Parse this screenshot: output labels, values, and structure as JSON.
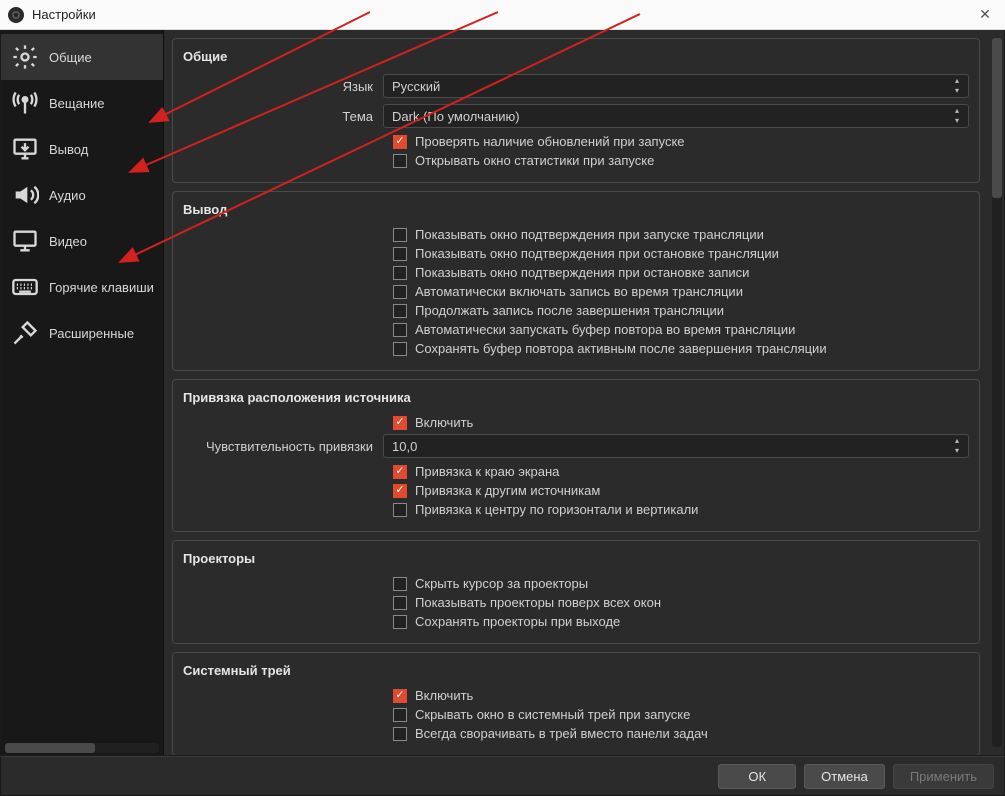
{
  "window": {
    "title": "Настройки"
  },
  "sidebar": {
    "items": [
      {
        "label": "Общие"
      },
      {
        "label": "Вещание"
      },
      {
        "label": "Вывод"
      },
      {
        "label": "Аудио"
      },
      {
        "label": "Видео"
      },
      {
        "label": "Горячие клавиши"
      },
      {
        "label": "Расширенные"
      }
    ]
  },
  "groups": {
    "general": {
      "title": "Общие",
      "language_label": "Язык",
      "language_value": "Русский",
      "theme_label": "Тема",
      "theme_value": "Dark (По умолчанию)",
      "checks": [
        {
          "label": "Проверять наличие обновлений при запуске",
          "checked": true
        },
        {
          "label": "Открывать окно статистики при запуске",
          "checked": false
        }
      ]
    },
    "output": {
      "title": "Вывод",
      "checks": [
        {
          "label": "Показывать окно подтверждения при запуске трансляции",
          "checked": false
        },
        {
          "label": "Показывать окно подтверждения при остановке трансляции",
          "checked": false
        },
        {
          "label": "Показывать окно подтверждения при остановке записи",
          "checked": false
        },
        {
          "label": "Автоматически включать запись во время трансляции",
          "checked": false
        },
        {
          "label": "Продолжать запись после завершения трансляции",
          "checked": false
        },
        {
          "label": "Автоматически запускать буфер повтора во время трансляции",
          "checked": false
        },
        {
          "label": "Сохранять буфер повтора активным после завершения трансляции",
          "checked": false
        }
      ]
    },
    "snap": {
      "title": "Привязка расположения источника",
      "enable": {
        "label": "Включить",
        "checked": true
      },
      "sensitivity_label": "Чувствительность привязки",
      "sensitivity_value": "10,0",
      "checks": [
        {
          "label": "Привязка к краю экрана",
          "checked": true
        },
        {
          "label": "Привязка к другим источникам",
          "checked": true
        },
        {
          "label": "Привязка к центру по горизонтали и вертикали",
          "checked": false
        }
      ]
    },
    "projectors": {
      "title": "Проекторы",
      "checks": [
        {
          "label": "Скрыть курсор за проекторы",
          "checked": false
        },
        {
          "label": "Показывать проекторы поверх всех окон",
          "checked": false
        },
        {
          "label": "Сохранять проекторы при выходе",
          "checked": false
        }
      ]
    },
    "tray": {
      "title": "Системный трей",
      "enable": {
        "label": "Включить",
        "checked": true
      },
      "checks": [
        {
          "label": "Скрывать окно в системный трей при запуске",
          "checked": false
        },
        {
          "label": "Всегда сворачивать в трей вместо панели задач",
          "checked": false
        }
      ]
    }
  },
  "footer": {
    "ok": "ОК",
    "cancel": "Отмена",
    "apply": "Применить"
  }
}
